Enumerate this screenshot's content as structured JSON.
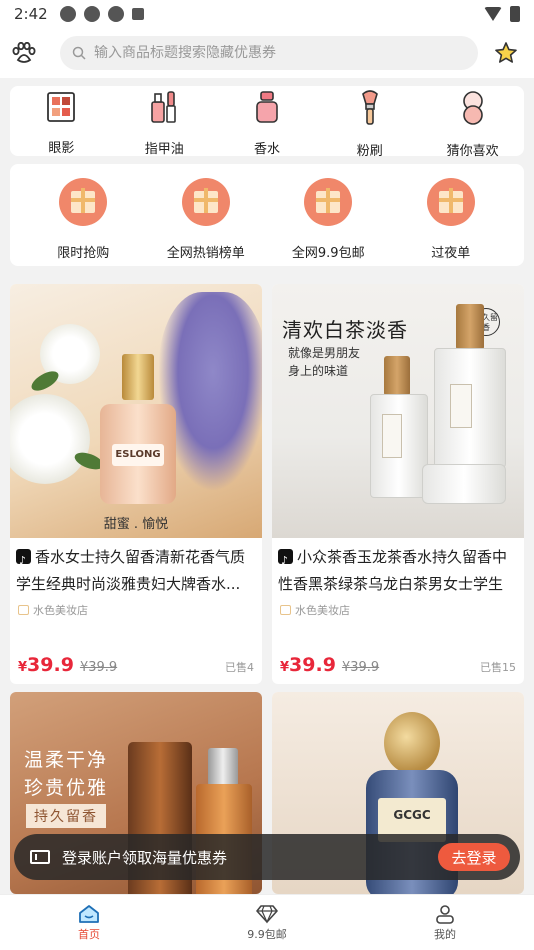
{
  "status_bar": {
    "time": "2:42"
  },
  "search": {
    "placeholder": "输入商品标题搜索隐藏优惠券"
  },
  "categories": [
    {
      "label": "眼影",
      "icon": "eyeshadow-palette-icon"
    },
    {
      "label": "指甲油",
      "icon": "nail-polish-icon"
    },
    {
      "label": "香水",
      "icon": "perfume-icon"
    },
    {
      "label": "粉刷",
      "icon": "makeup-brush-icon"
    },
    {
      "label": "猜你喜欢",
      "icon": "compact-mirror-icon"
    }
  ],
  "promos": [
    {
      "label": "限时抢购",
      "icon": "gift-icon"
    },
    {
      "label": "全网热销榜单",
      "icon": "gift-icon"
    },
    {
      "label": "全网9.9包邮",
      "icon": "gift-icon"
    },
    {
      "label": "过夜单",
      "icon": "gift-icon"
    }
  ],
  "products": [
    {
      "title": "香水女士持久留香清新花香气质学生经典时尚淡雅贵妇大牌香水...",
      "shop": "水色美妆店",
      "currency": "¥",
      "price": "39.9",
      "original_price": "¥39.9",
      "sold": "已售4",
      "image_brand": "ESLONG",
      "image_caption": "甜蜜 . 愉悦"
    },
    {
      "title": "小众茶香玉龙茶香水持久留香中性香黑茶绿茶乌龙白茶男女士学生",
      "shop": "水色美妆店",
      "currency": "¥",
      "price": "39.9",
      "original_price": "¥39.9",
      "sold": "已售15",
      "image_heading": "清欢白茶淡香",
      "image_sub1": "就像是男朋友",
      "image_sub2": "身上的味道",
      "image_badge": "持久留香"
    },
    {
      "image_line1": "温柔干净",
      "image_line2": "珍贵优雅",
      "image_tag": "持久留香"
    },
    {
      "image_brand": "GCGC"
    }
  ],
  "login_banner": {
    "text": "登录账户领取海量优惠券",
    "button": "去登录"
  },
  "bottom_nav": [
    {
      "label": "首页",
      "icon": "home-icon",
      "active": true
    },
    {
      "label": "9.9包邮",
      "icon": "diamond-icon",
      "active": false
    },
    {
      "label": "我的",
      "icon": "profile-icon",
      "active": false
    }
  ],
  "colors": {
    "accent": "#e74a35",
    "price": "#e8273a",
    "gift": "#f0876a"
  }
}
